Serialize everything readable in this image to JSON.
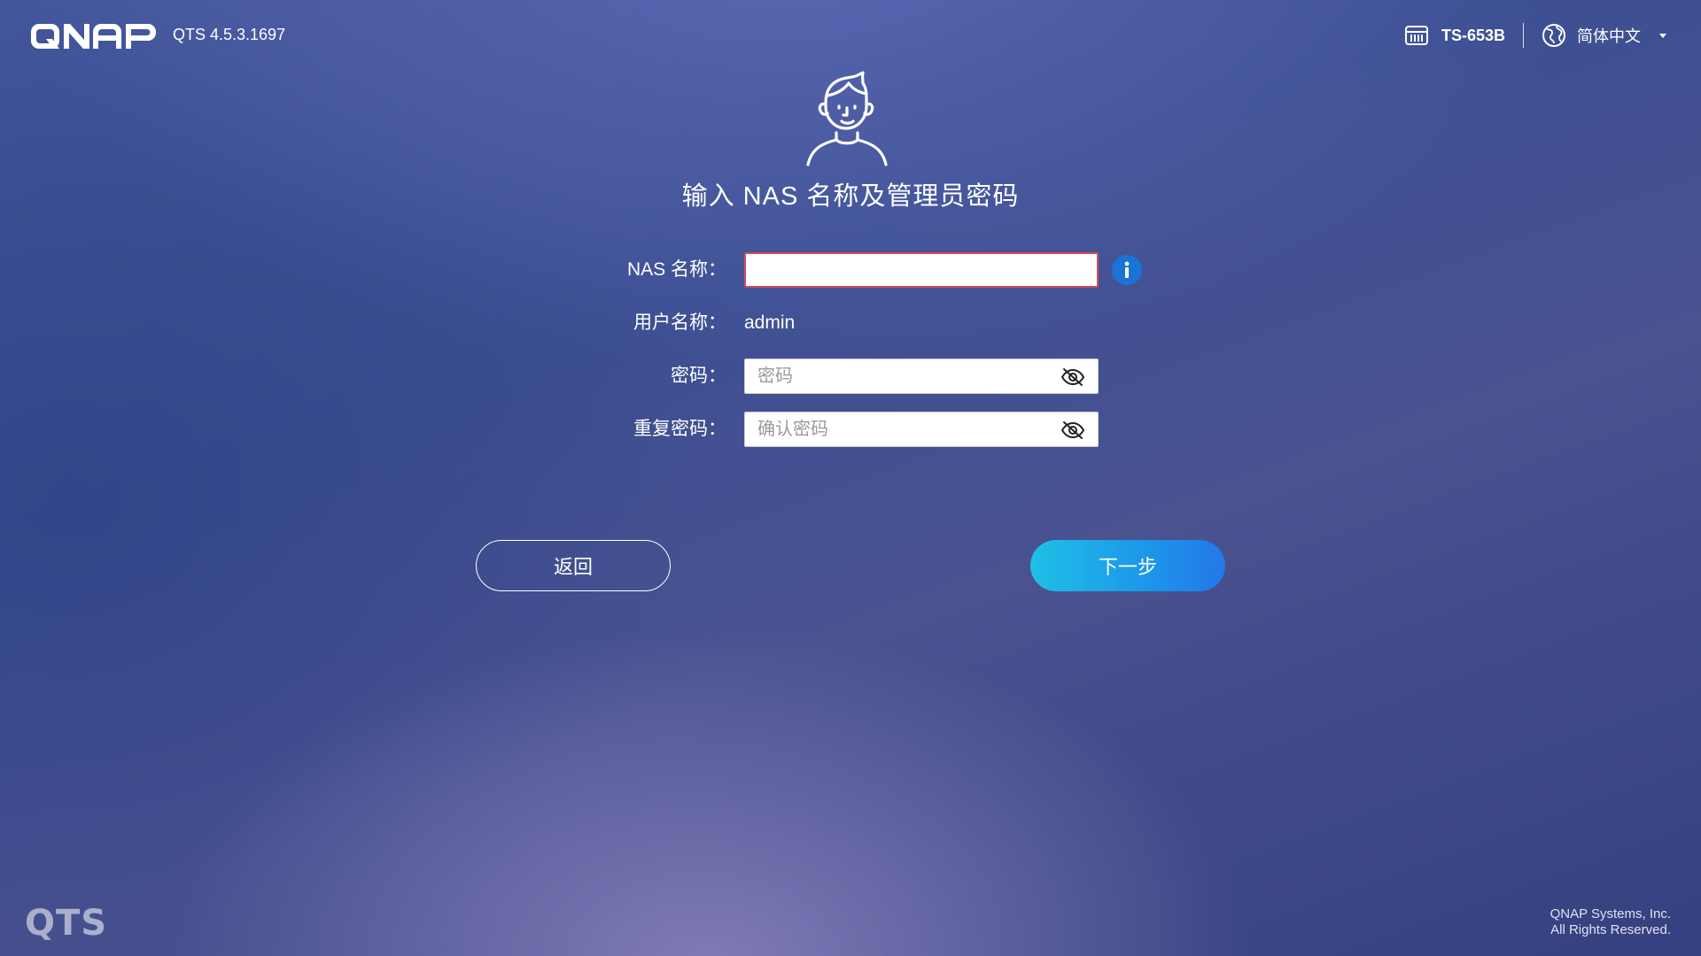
{
  "header": {
    "brand": "QNAP",
    "version": "QTS 4.5.3.1697",
    "device_name": "TS-653B",
    "language": "简体中文"
  },
  "hero": {
    "title": "输入 NAS 名称及管理员密码"
  },
  "form": {
    "nas_name": {
      "label": "NAS 名称：",
      "value": ""
    },
    "username": {
      "label": "用户名称：",
      "value": "admin"
    },
    "password": {
      "label": "密码：",
      "placeholder": "密码"
    },
    "confirm_password": {
      "label": "重复密码：",
      "placeholder": "确认密码"
    }
  },
  "buttons": {
    "back": "返回",
    "next": "下一步"
  },
  "footer": {
    "product_logo": "QTS",
    "company": "QNAP Systems, Inc.",
    "rights": "All Rights Reserved."
  },
  "colors": {
    "accent_start": "#1fc0e6",
    "accent_end": "#2478e6",
    "error_border": "#d24a5a",
    "info_blue": "#1a73d6"
  },
  "icons": [
    "qnap-logo",
    "nas-device-icon",
    "globe-icon",
    "chevron-down-icon",
    "user-avatar-icon",
    "info-icon",
    "eye-off-icon"
  ]
}
